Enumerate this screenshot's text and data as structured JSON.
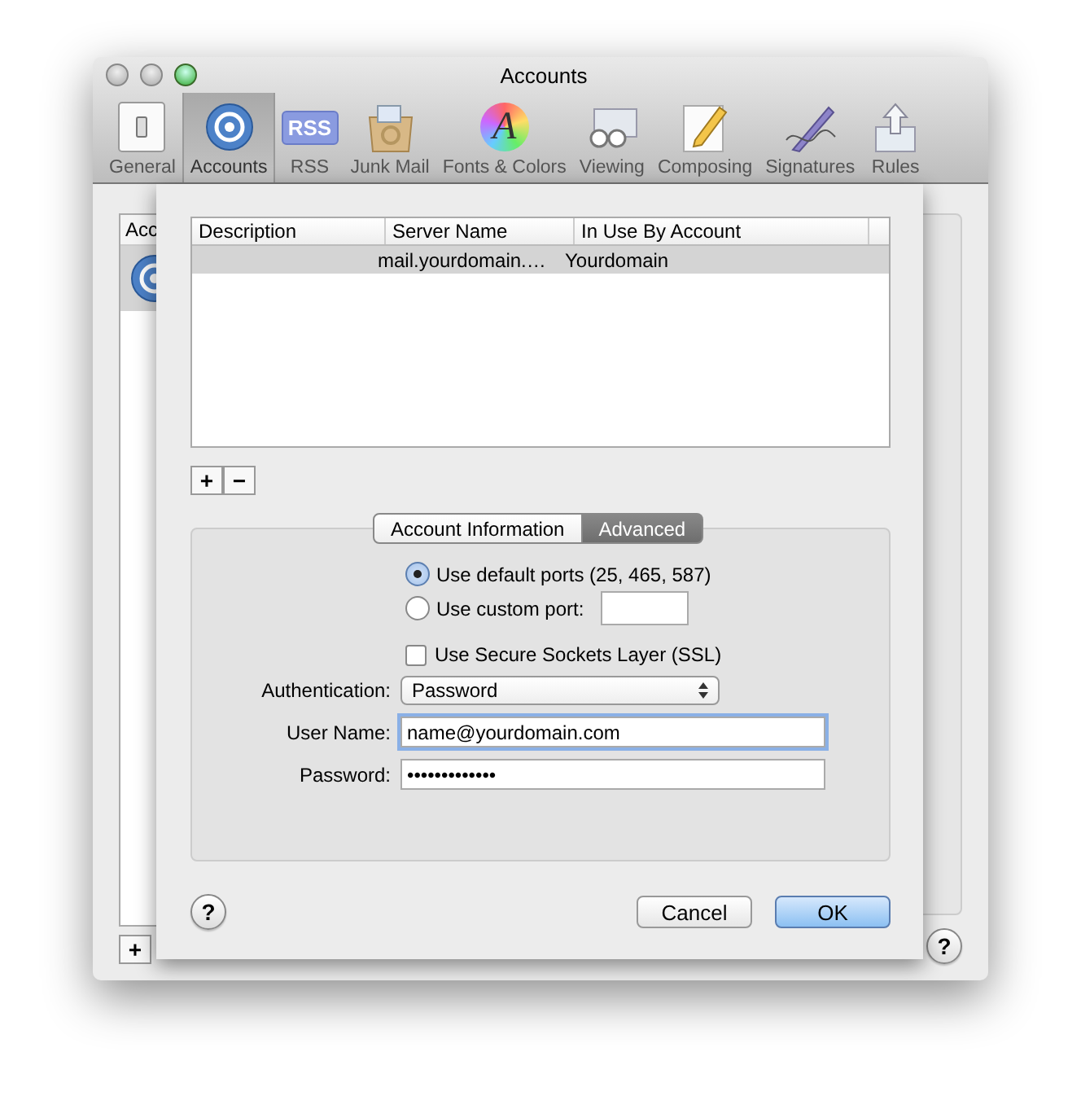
{
  "window": {
    "title": "Accounts"
  },
  "toolbar": [
    {
      "label": "General",
      "selected": false
    },
    {
      "label": "Accounts",
      "selected": true
    },
    {
      "label": "RSS",
      "selected": false,
      "badge": "RSS"
    },
    {
      "label": "Junk Mail",
      "selected": false
    },
    {
      "label": "Fonts & Colors",
      "selected": false,
      "badge": "A"
    },
    {
      "label": "Viewing",
      "selected": false
    },
    {
      "label": "Composing",
      "selected": false
    },
    {
      "label": "Signatures",
      "selected": false
    },
    {
      "label": "Rules",
      "selected": false
    }
  ],
  "accounts_list": {
    "header": "Acc",
    "add_button": "+"
  },
  "help_button": "?",
  "sheet": {
    "table": {
      "columns": [
        "Description",
        "Server Name",
        "In Use By Account"
      ],
      "rows": [
        {
          "server_name": "mail.yourdomain.…",
          "in_use_by_account": "Yourdomain",
          "selected": true
        }
      ]
    },
    "add_button": "+",
    "remove_button": "−",
    "tabs": [
      {
        "label": "Account Information",
        "selected": false
      },
      {
        "label": "Advanced",
        "selected": true
      }
    ],
    "ports": [
      {
        "label": "Use default ports (25, 465, 587)",
        "selected": true,
        "kind": "plain"
      },
      {
        "label": "Use custom port:",
        "selected": false,
        "kind": "with_field"
      }
    ],
    "ssl": {
      "label": "Use Secure Sockets Layer (SSL)",
      "checked": false
    },
    "authentication": {
      "label": "Authentication:",
      "value": "Password"
    },
    "user_name": {
      "label": "User Name:",
      "value": "name@yourdomain.com",
      "focused": true
    },
    "password": {
      "label": "Password:",
      "value": "•••••••••••••",
      "focused": false
    },
    "help_button": "?",
    "buttons": [
      {
        "label": "Cancel",
        "kind": "normal"
      },
      {
        "label": "OK",
        "kind": "default"
      }
    ]
  }
}
